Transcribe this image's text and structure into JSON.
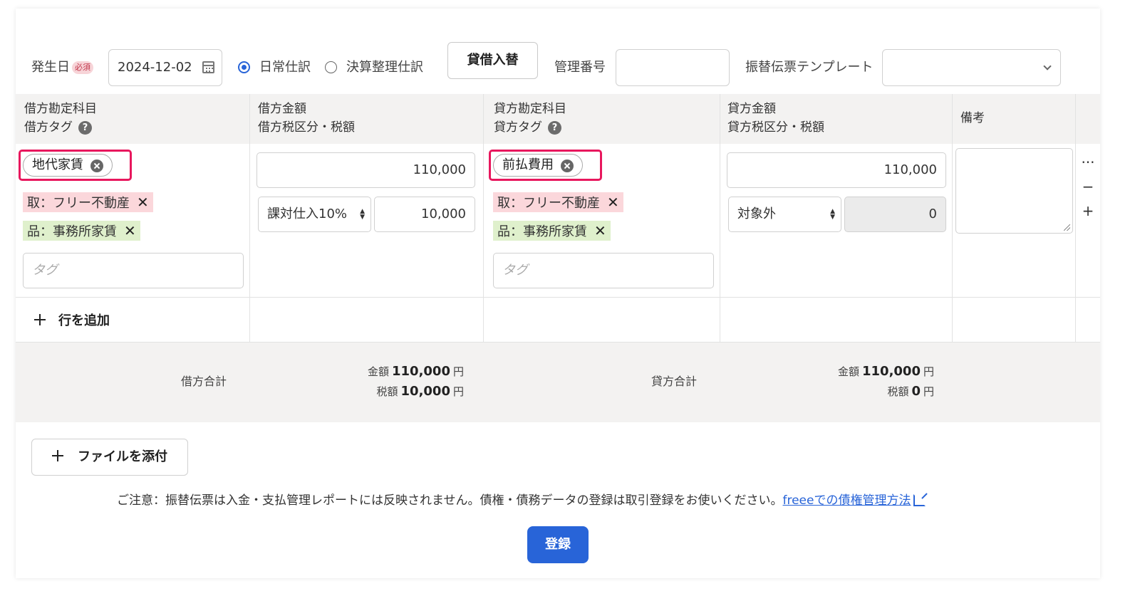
{
  "header": {
    "date_label": "発生日",
    "required_badge": "必須",
    "date_value": "2024-12-02",
    "radio_normal_label": "日常仕訳",
    "radio_closing_label": "決算整理仕訳",
    "selected_radio": "日常仕訳",
    "swap_button": "貸借入替",
    "mgmt_number_label": "管理番号",
    "mgmt_number_value": "",
    "template_label": "振替伝票テンプレート",
    "template_value": ""
  },
  "columns": {
    "debit_account": "借方勘定科目",
    "debit_tag": "借方タグ",
    "debit_amount": "借方金額",
    "debit_tax": "借方税区分・税額",
    "credit_account": "貸方勘定科目",
    "credit_tag": "貸方タグ",
    "credit_amount": "貸方金額",
    "credit_tax": "貸方税区分・税額",
    "memo": "備考"
  },
  "row": {
    "debit": {
      "account": "地代家賃",
      "tags": [
        "取：フリー不動産",
        "品：事務所家賃"
      ],
      "tag_placeholder": "タグ",
      "amount": "110,000",
      "tax_category": "課対仕入10%",
      "tax_amount": "10,000"
    },
    "credit": {
      "account": "前払費用",
      "tags": [
        "取：フリー不動産",
        "品：事務所家賃"
      ],
      "tag_placeholder": "タグ",
      "amount": "110,000",
      "tax_category": "対象外",
      "tax_amount": "0"
    },
    "memo": "",
    "controls": [
      "···",
      "−",
      "+"
    ]
  },
  "add_row": "行を追加",
  "totals": {
    "debit_label": "借方合計",
    "credit_label": "貸方合計",
    "amount_label": "金額",
    "tax_label": "税額",
    "currency": "円",
    "debit_amount": "110,000",
    "debit_tax": "10,000",
    "credit_amount": "110,000",
    "credit_tax": "0"
  },
  "attach_button": "ファイルを添付",
  "note_text": "ご注意：振替伝票は入金・支払管理レポートには反映されません。債権・債務データの登録は取引登録をお使いください。",
  "note_link": "freeeでの債権管理方法",
  "submit_button": "登録",
  "colors": {
    "accent": "#2864d8",
    "highlight": "#e8175d",
    "tag_pink": "#fbd7db",
    "tag_green": "#dff0cc"
  }
}
